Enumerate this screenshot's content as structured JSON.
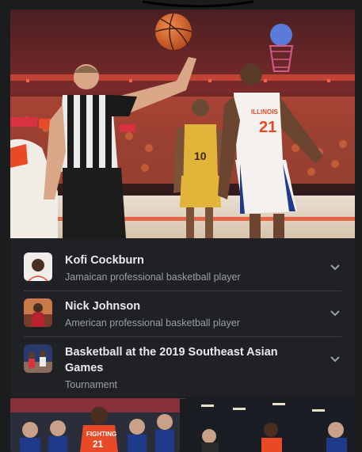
{
  "hero": {
    "image": "Basketball jump ball photo: referee tossing ball between player in gold uniform number 10 and player in white Illinois uniform number 21",
    "jersey_left": "10",
    "jersey_right": "21",
    "jersey_right_team": "ILLINOIS"
  },
  "entities": [
    {
      "title": "Kofi Cockburn",
      "subtitle": "Jamaican professional basketball player",
      "thumb": "player-portrait"
    },
    {
      "title": "Nick Johnson",
      "subtitle": "American professional basketball player",
      "thumb": "player-action"
    },
    {
      "title": "Basketball at the 2019 Southeast Asian Games",
      "subtitle": "Tournament",
      "thumb": "game-action"
    }
  ],
  "bottom": {
    "left_jersey_text": "FIGHTING",
    "left_jersey_number": "21"
  },
  "colors": {
    "background": "#1b1c1e",
    "card": "#202124",
    "divider": "#3c4043",
    "title": "#e8eaed",
    "subtitle": "#9aa0a6",
    "illinois_orange": "#e84a27"
  }
}
